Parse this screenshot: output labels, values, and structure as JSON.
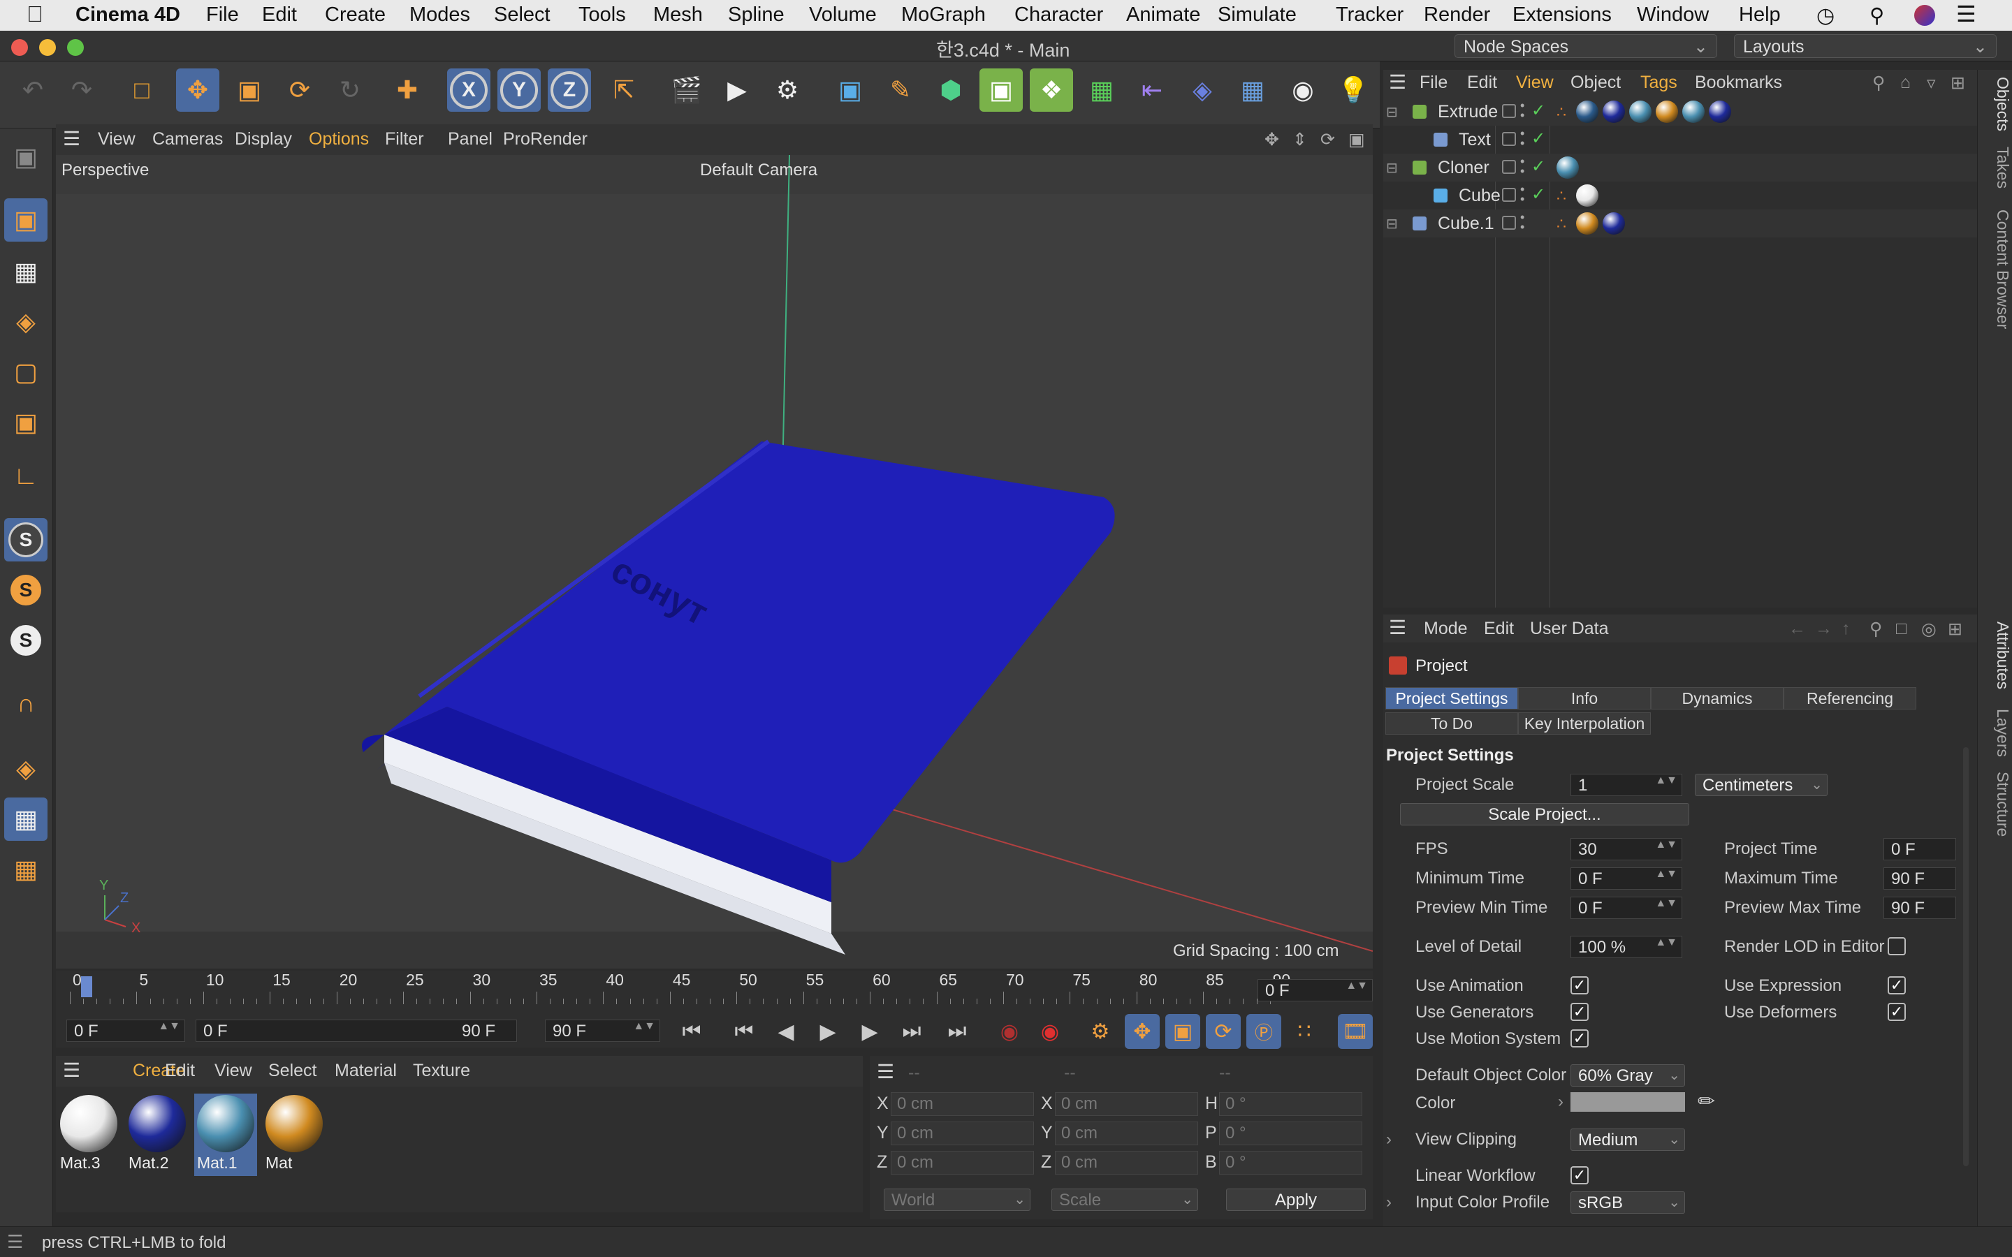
{
  "menubar": {
    "app_name": "Cinema 4D",
    "items": [
      "File",
      "Edit",
      "Create",
      "Modes",
      "Select",
      "Tools",
      "Mesh",
      "Spline",
      "Volume",
      "MoGraph",
      "Character",
      "Animate",
      "Simulate",
      "Tracker",
      "Render",
      "Extensions",
      "Window",
      "Help"
    ]
  },
  "window": {
    "title": "한3.c4d * - Main",
    "node_spaces": "Node Spaces",
    "layouts": "Layouts"
  },
  "viewport": {
    "menu": [
      "View",
      "Cameras",
      "Display",
      "Options",
      "Filter",
      "Panel",
      "ProRender"
    ],
    "active_menu": "Options",
    "view_name": "Perspective",
    "camera": "Default Camera",
    "grid_spacing": "Grid Spacing : 100 cm",
    "book_text": "сонут",
    "axes": {
      "x": "X",
      "y": "Y",
      "z": "Z"
    }
  },
  "timeline": {
    "ticks": [
      "0",
      "5",
      "10",
      "15",
      "20",
      "25",
      "30",
      "35",
      "40",
      "45",
      "50",
      "55",
      "60",
      "65",
      "70",
      "75",
      "80",
      "85",
      "90"
    ],
    "current_frame": "0 F",
    "start_field": "0 F",
    "range_start": "0 F",
    "range_end": "90 F",
    "end_field": "90 F"
  },
  "material_manager": {
    "menu": [
      "Create",
      "Edit",
      "View",
      "Select",
      "Material",
      "Texture"
    ],
    "active_menu": "Create",
    "materials": [
      {
        "name": "Mat.3",
        "color": "#e8e8e8",
        "selected": false
      },
      {
        "name": "Mat.2",
        "color": "#1e2a9a",
        "selected": false
      },
      {
        "name": "Mat.1",
        "color": "#4a8fb0",
        "selected": true
      },
      {
        "name": "Mat",
        "color": "#d08a20",
        "selected": false
      }
    ]
  },
  "coordinates": {
    "headers": [
      "--",
      "--",
      "--"
    ],
    "rows": [
      {
        "a": "X",
        "av": "0 cm",
        "b": "X",
        "bv": "0 cm",
        "c": "H",
        "cv": "0 °"
      },
      {
        "a": "Y",
        "av": "0 cm",
        "b": "Y",
        "bv": "0 cm",
        "c": "P",
        "cv": "0 °"
      },
      {
        "a": "Z",
        "av": "0 cm",
        "b": "Z",
        "bv": "0 cm",
        "c": "B",
        "cv": "0 °"
      }
    ],
    "space": "World",
    "mode": "Scale",
    "apply": "Apply"
  },
  "status": {
    "text": "press CTRL+LMB to fold"
  },
  "object_manager": {
    "menu": [
      "File",
      "Edit",
      "View",
      "Object",
      "Tags",
      "Bookmarks"
    ],
    "highlight": [
      "View",
      "Tags"
    ],
    "objects": [
      {
        "name": "Extrude",
        "indent": 0
      },
      {
        "name": "Text",
        "indent": 1
      },
      {
        "name": "Cloner",
        "indent": 0
      },
      {
        "name": "Cube",
        "indent": 1
      },
      {
        "name": "Cube.1",
        "indent": 0
      }
    ]
  },
  "side_tabs": {
    "top": [
      "Objects",
      "Takes",
      "Content Browser"
    ],
    "bottom": [
      "Attributes",
      "Layers",
      "Structure"
    ]
  },
  "attributes": {
    "menu": [
      "Mode",
      "Edit",
      "User Data"
    ],
    "object_name": "Project",
    "tabs_row1": [
      "Project Settings",
      "Info",
      "Dynamics",
      "Referencing"
    ],
    "tabs_row2": [
      "To Do",
      "Key Interpolation"
    ],
    "section": "Project Settings",
    "project_scale_label": "Project Scale",
    "project_scale_value": "1",
    "project_scale_unit": "Centimeters",
    "scale_project_button": "Scale Project...",
    "fps_label": "FPS",
    "fps_value": "30",
    "project_time_label": "Project Time",
    "project_time_value": "0 F",
    "min_time_label": "Minimum Time",
    "min_time_value": "0 F",
    "max_time_label": "Maximum Time",
    "max_time_value": "90 F",
    "prev_min_label": "Preview Min Time",
    "prev_min_value": "0 F",
    "prev_max_label": "Preview Max Time",
    "prev_max_value": "90 F",
    "lod_label": "Level of Detail",
    "lod_value": "100 %",
    "render_lod_label": "Render LOD in Editor",
    "use_animation_label": "Use Animation",
    "use_expression_label": "Use Expression",
    "use_generators_label": "Use Generators",
    "use_deformers_label": "Use Deformers",
    "use_motion_label": "Use Motion System",
    "default_color_label": "Default Object Color",
    "default_color_value": "60% Gray",
    "color_label": "Color",
    "view_clipping_label": "View Clipping",
    "view_clipping_value": "Medium",
    "linear_workflow_label": "Linear Workflow",
    "input_profile_label": "Input Color Profile",
    "input_profile_value": "sRGB"
  }
}
